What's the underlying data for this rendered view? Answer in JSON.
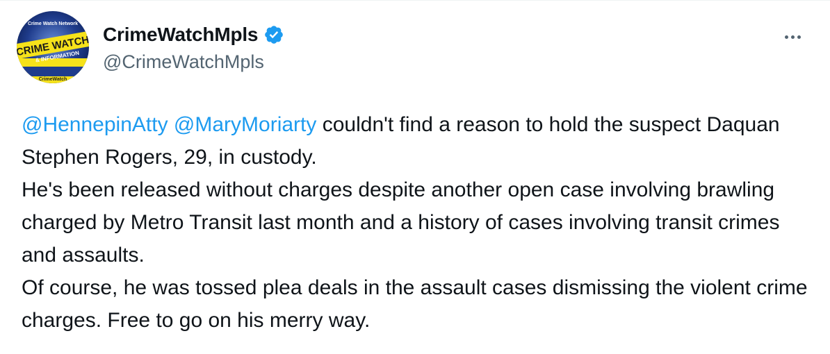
{
  "author": {
    "display_name": "CrimeWatchMpls",
    "handle": "@CrimeWatchMpls",
    "verified": true,
    "avatar_text": {
      "top": "Crime Watch Network",
      "main": "CRIME WATCH",
      "sub": "& INFORMATION",
      "bottom": "CrimeWatch"
    }
  },
  "more_icon": "more-horizontal-icon",
  "tweet": {
    "mention_1": "@HennepinAtty",
    "mention_2": "@MaryMoriarty",
    "line_1_rest": " couldn't find a reason to hold the suspect Daquan Stephen Rogers, 29, in custody.",
    "paragraph_2": "He's been released without charges despite another open case involving brawling charged by Metro Transit last month and a history of cases involving transit crimes and assaults.",
    "paragraph_3": "Of course, he was tossed plea deals in the assault cases dismissing the violent crime charges. Free to go on his merry way."
  },
  "colors": {
    "link": "#1d9bf0",
    "text": "#0f1419",
    "secondary": "#536471",
    "verified": "#1d9bf0"
  }
}
